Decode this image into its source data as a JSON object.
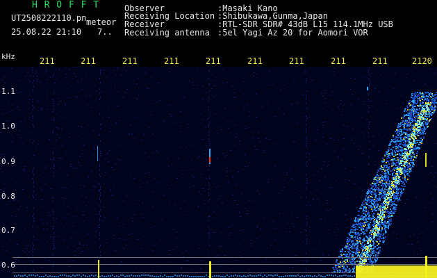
{
  "header": {
    "app_name": "H R O F F T",
    "filename": "UT2508222110.pn",
    "event_type": "meteor",
    "datetime": "25.08.22 21:10",
    "counter": "7..",
    "info": [
      {
        "label": "Observer",
        "value": ":Masaki Kano"
      },
      {
        "label": "Receiving Location",
        "value": ":Shibukawa,Gunma,Japan"
      },
      {
        "label": "Receiver",
        "value": ":RTL-SDR SDR# 43dB L15 114.1MHz USB"
      },
      {
        "label": "Receiving antenna",
        "value": ":5el Yagi Az 20 for Aomori VOR"
      }
    ]
  },
  "y_axis": {
    "unit": "kHz",
    "ticks": [
      "1.1",
      "1.0",
      "0.9",
      "0.8",
      "0.7",
      "0.6"
    ]
  },
  "x_axis": {
    "ticks": [
      "211",
      "211",
      "211",
      "211",
      "211",
      "211",
      "211",
      "211",
      "211",
      "2120"
    ]
  },
  "colors": {
    "background": "#000000",
    "label_green": "#2fe05a",
    "tick_yellow": "#f0e84a",
    "noise_blue": "#0a1a6e",
    "signal_cyan": "#2aa8ff",
    "signal_yellow": "#f5f020",
    "signal_red": "#ff2a10"
  }
}
